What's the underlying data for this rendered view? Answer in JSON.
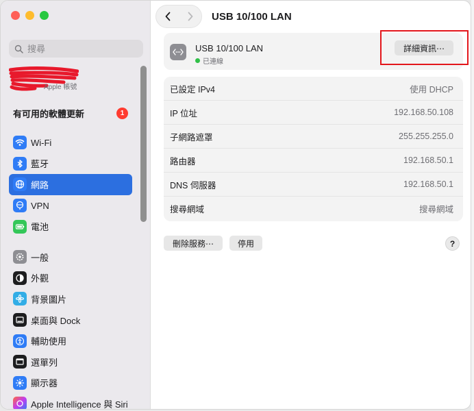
{
  "window": {
    "title": "USB 10/100 LAN"
  },
  "sidebar": {
    "search_placeholder": "搜尋",
    "account_label": "Apple 帳號",
    "update_label": "有可用的軟體更新",
    "update_count": "1",
    "items": [
      {
        "label": "Wi-Fi",
        "icon": "wifi-icon",
        "color": "#2f7cf6"
      },
      {
        "label": "藍牙",
        "icon": "bluetooth-icon",
        "color": "#2f7cf6"
      },
      {
        "label": "網路",
        "icon": "globe-icon",
        "color": "#2f7cf6"
      },
      {
        "label": "VPN",
        "icon": "vpn-icon",
        "color": "#2f7cf6"
      },
      {
        "label": "電池",
        "icon": "battery-icon",
        "color": "#34c759"
      },
      {
        "label": "一般",
        "icon": "gear-icon",
        "color": "#8e8e93"
      },
      {
        "label": "外觀",
        "icon": "appearance-icon",
        "color": "#1d1d1f"
      },
      {
        "label": "背景圖片",
        "icon": "wallpaper-icon",
        "color": "#32ade6"
      },
      {
        "label": "桌面與 Dock",
        "icon": "dock-icon",
        "color": "#1d1d1f"
      },
      {
        "label": "輔助使用",
        "icon": "accessibility-icon",
        "color": "#2f7cf6"
      },
      {
        "label": "選單列",
        "icon": "menubar-icon",
        "color": "#1d1d1f"
      },
      {
        "label": "顯示器",
        "icon": "display-icon",
        "color": "#2f7cf6"
      },
      {
        "label": "Apple Intelligence 與 Siri",
        "icon": "siri-icon",
        "color": "#ff6b3d"
      }
    ]
  },
  "service": {
    "name": "USB 10/100 LAN",
    "status": "已連線",
    "status_color": "#30c048",
    "details_label": "詳細資訊⋯"
  },
  "info_rows": [
    {
      "key": "已設定 IPv4",
      "value": "使用 DHCP"
    },
    {
      "key": "IP 位址",
      "value": "192.168.50.108"
    },
    {
      "key": "子網路遮罩",
      "value": "255.255.255.0"
    },
    {
      "key": "路由器",
      "value": "192.168.50.1"
    },
    {
      "key": "DNS 伺服器",
      "value": "192.168.50.1"
    },
    {
      "key": "搜尋網域",
      "value": "搜尋網域"
    }
  ],
  "actions": {
    "delete_label": "刪除服務⋯",
    "disable_label": "停用",
    "help_label": "?"
  },
  "colors": {
    "accent": "#2c6fe0",
    "highlight": "#e3161b"
  }
}
